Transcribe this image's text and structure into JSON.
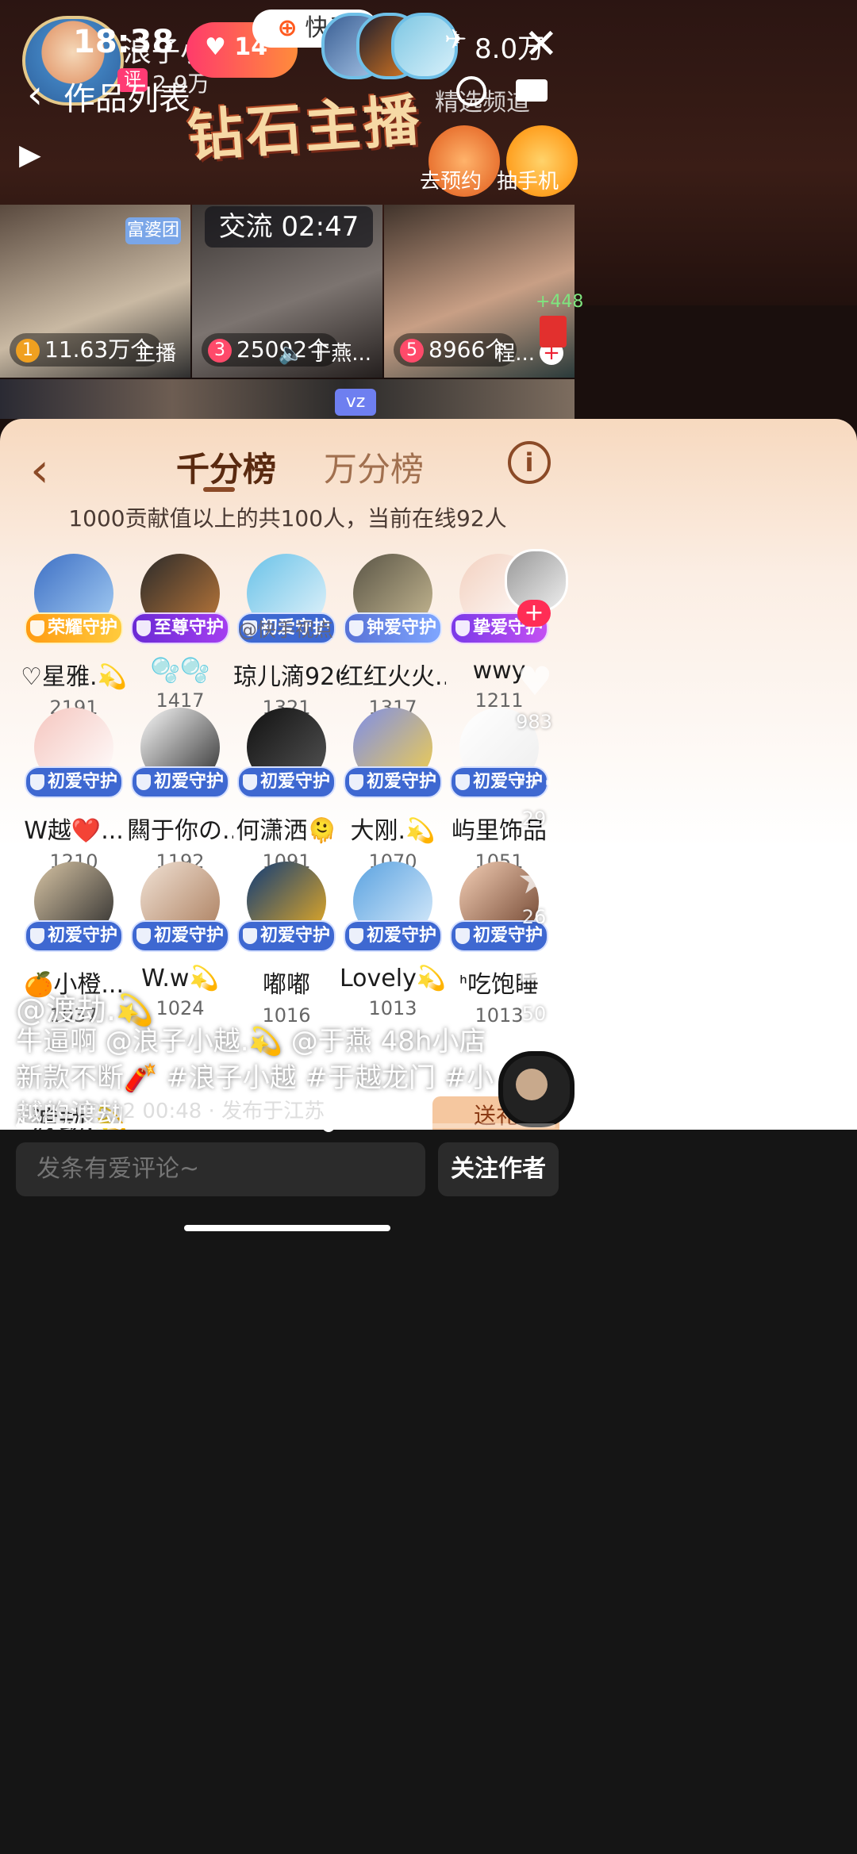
{
  "status": {
    "time": "18:38",
    "battery_or_count": "8.0万"
  },
  "host": {
    "name": "浪子小越...",
    "badge": "评",
    "fans": "2.9万",
    "hearts": "14"
  },
  "brand": {
    "app_name": "快手"
  },
  "nav": {
    "back_title": "作品列表",
    "channel_label": "精选频道"
  },
  "banner": {
    "title": "钻石主播",
    "gift1": "去预约",
    "gift2": "抽手机"
  },
  "live": {
    "timer_label": "交流 02:47",
    "tile_badge": "富婆团",
    "tiles": [
      {
        "rank": "1",
        "value": "11.63万个",
        "label": "主播"
      },
      {
        "rank": "3",
        "value": "25092个",
        "label": "于燕..."
      },
      {
        "rank": "5",
        "value": "8966个",
        "label": "程..."
      }
    ],
    "plus": "+448",
    "vz": "vz"
  },
  "panel": {
    "tab_active": "千分榜",
    "tab_inactive": "万分榜",
    "subtitle": "1000贡献值以上的共100人，当前在线92人",
    "rows": [
      [
        {
          "badge": "荣耀守护",
          "name": "♡星雅.💫",
          "score": "2191",
          "style": "gold"
        },
        {
          "badge": "至尊守护",
          "name": "🫧🫧",
          "score": "1417",
          "style": "purple"
        },
        {
          "badge": "初爱守护",
          "name": "琼儿滴926",
          "score": "1321",
          "style": "blue"
        },
        {
          "badge": "钟爱守护",
          "name": "红红火火...",
          "score": "1317",
          "style": "cyan"
        },
        {
          "badge": "挚爱守护",
          "name": "wwy",
          "score": "1211",
          "style": "violet"
        }
      ],
      [
        {
          "badge": "初爱守护",
          "name": "W越❤️...",
          "score": "1210",
          "style": "blue"
        },
        {
          "badge": "初爱守护",
          "name": "闗于你の...",
          "score": "1192",
          "style": "blue"
        },
        {
          "badge": "初爱守护",
          "name": "何潇洒🫠",
          "score": "1091",
          "style": "blue"
        },
        {
          "badge": "初爱守护",
          "name": "大刚.💫",
          "score": "1070",
          "style": "blue"
        },
        {
          "badge": "初爱守护",
          "name": "屿里饰品",
          "score": "1051",
          "style": "blue"
        }
      ],
      [
        {
          "badge": "初爱守护",
          "name": "🍊小橙...",
          "score": "1037",
          "style": "blue"
        },
        {
          "badge": "初爱守护",
          "name": "W.w💫",
          "score": "1024",
          "style": "blue"
        },
        {
          "badge": "初爱守护",
          "name": "嘟嘟",
          "score": "1016",
          "style": "blue"
        },
        {
          "badge": "初爱守护",
          "name": "Lovely💫",
          "score": "1013",
          "style": "blue"
        },
        {
          "badge": "初爱守护",
          "name": "ᑋ吃饱睡",
          "score": "1013",
          "style": "blue"
        }
      ]
    ],
    "watermark": "@快手视点",
    "send_gift": "送礼",
    "author_inline": "渡劫.💫"
  },
  "rail": {
    "likes": "983",
    "comments": "29",
    "favorites": "26",
    "shares": "50"
  },
  "post": {
    "author": "@渡劫.💫",
    "description": "牛逼啊 @浪子小越.💫 @于燕 48h小店新款不断🧨 #浪子小越 #于越龙门 #小越的渡劫",
    "meta": "2026-02-02 00:48 · 发布于江苏",
    "progress": 0.58
  },
  "bottom": {
    "comment_placeholder": "发条有爱评论~",
    "follow_label": "关注作者"
  }
}
